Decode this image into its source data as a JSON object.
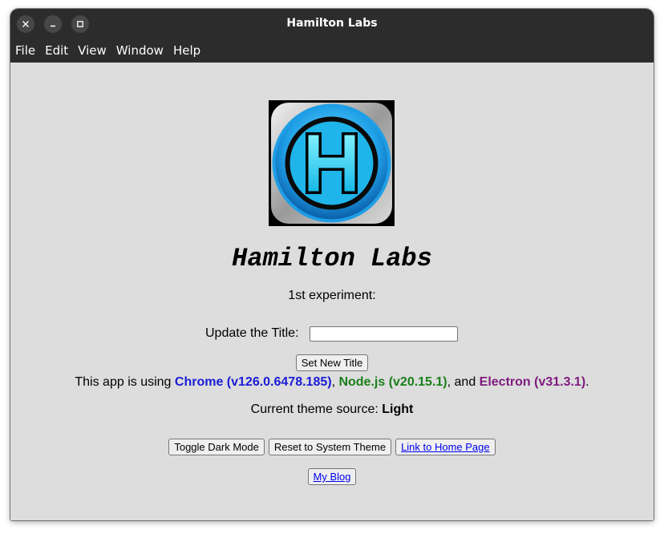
{
  "window": {
    "title": "Hamilton Labs",
    "controls": {
      "close_icon": "close-icon",
      "minimize_icon": "minimize-icon",
      "maximize_icon": "maximize-icon"
    }
  },
  "menu": [
    "File",
    "Edit",
    "View",
    "Window",
    "Help"
  ],
  "logo": {
    "letter": "H",
    "icon": "hamilton-labs-logo"
  },
  "app_title": "Hamilton Labs",
  "experiment_label": "1st experiment:",
  "title_field": {
    "label": "Update the Title:",
    "value": "",
    "placeholder": ""
  },
  "set_title_button": "Set New Title",
  "versions": {
    "prefix": "This app is using ",
    "chrome": "Chrome (v126.0.6478.185)",
    "sep1": ", ",
    "node": "Node.js (v20.15.1)",
    "sep2": ", and ",
    "electron": "Electron (v31.3.1)",
    "suffix": "."
  },
  "theme": {
    "label": "Current theme source: ",
    "value": "Light"
  },
  "buttons": {
    "toggle_dark": "Toggle Dark Mode",
    "reset_theme": "Reset to System Theme",
    "home_link": "Link to Home Page",
    "blog_link": "My Blog"
  },
  "colors": {
    "titlebar": "#2c2c2c",
    "content_bg": "#dddddd",
    "chrome_text": "#1a1ad6",
    "node_text": "#1b7f1b",
    "electron_text": "#7e1a7e",
    "logo_ring": "#1e9ee6"
  }
}
